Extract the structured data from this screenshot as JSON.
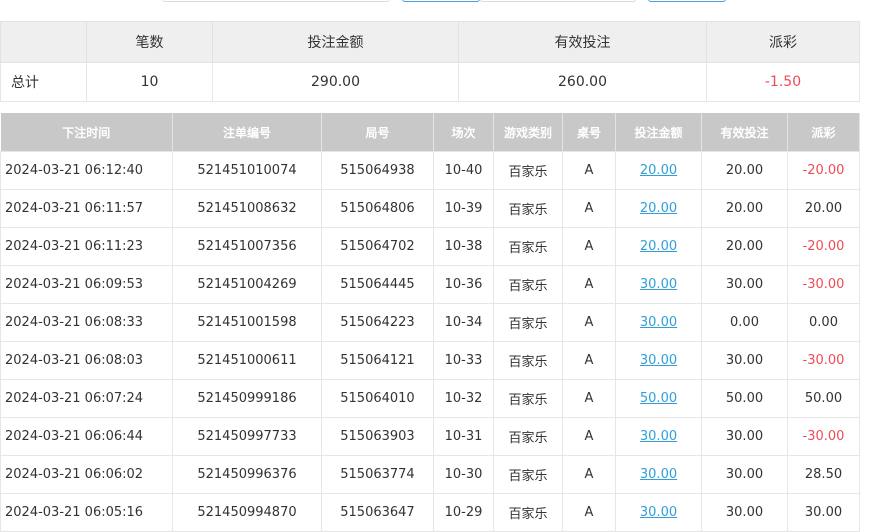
{
  "summary": {
    "headers": [
      "",
      "笔数",
      "投注金额",
      "有效投注",
      "派彩"
    ],
    "row": {
      "label": "总计",
      "count": "10",
      "bet_amount": "290.00",
      "valid_bet": "260.00",
      "payout": "-1.50"
    }
  },
  "detail": {
    "headers": [
      "下注时间",
      "注单编号",
      "局号",
      "场次",
      "游戏类别",
      "桌号",
      "投注金额",
      "有效投注",
      "派彩"
    ],
    "rows": [
      {
        "time": "2024-03-21 06:12:40",
        "bet_id": "521451010074",
        "round_id": "515064938",
        "session": "10-40",
        "game": "百家乐",
        "table": "A",
        "bet_amount": "20.00",
        "valid_bet": "20.00",
        "payout": "-20.00"
      },
      {
        "time": "2024-03-21 06:11:57",
        "bet_id": "521451008632",
        "round_id": "515064806",
        "session": "10-39",
        "game": "百家乐",
        "table": "A",
        "bet_amount": "20.00",
        "valid_bet": "20.00",
        "payout": "20.00"
      },
      {
        "time": "2024-03-21 06:11:23",
        "bet_id": "521451007356",
        "round_id": "515064702",
        "session": "10-38",
        "game": "百家乐",
        "table": "A",
        "bet_amount": "20.00",
        "valid_bet": "20.00",
        "payout": "-20.00"
      },
      {
        "time": "2024-03-21 06:09:53",
        "bet_id": "521451004269",
        "round_id": "515064445",
        "session": "10-36",
        "game": "百家乐",
        "table": "A",
        "bet_amount": "30.00",
        "valid_bet": "30.00",
        "payout": "-30.00"
      },
      {
        "time": "2024-03-21 06:08:33",
        "bet_id": "521451001598",
        "round_id": "515064223",
        "session": "10-34",
        "game": "百家乐",
        "table": "A",
        "bet_amount": "30.00",
        "valid_bet": "0.00",
        "payout": "0.00"
      },
      {
        "time": "2024-03-21 06:08:03",
        "bet_id": "521451000611",
        "round_id": "515064121",
        "session": "10-33",
        "game": "百家乐",
        "table": "A",
        "bet_amount": "30.00",
        "valid_bet": "30.00",
        "payout": "-30.00"
      },
      {
        "time": "2024-03-21 06:07:24",
        "bet_id": "521450999186",
        "round_id": "515064010",
        "session": "10-32",
        "game": "百家乐",
        "table": "A",
        "bet_amount": "50.00",
        "valid_bet": "50.00",
        "payout": "50.00"
      },
      {
        "time": "2024-03-21 06:06:44",
        "bet_id": "521450997733",
        "round_id": "515063903",
        "session": "10-31",
        "game": "百家乐",
        "table": "A",
        "bet_amount": "30.00",
        "valid_bet": "30.00",
        "payout": "-30.00"
      },
      {
        "time": "2024-03-21 06:06:02",
        "bet_id": "521450996376",
        "round_id": "515063774",
        "session": "10-30",
        "game": "百家乐",
        "table": "A",
        "bet_amount": "30.00",
        "valid_bet": "30.00",
        "payout": "28.50"
      },
      {
        "time": "2024-03-21 06:05:16",
        "bet_id": "521450994870",
        "round_id": "515063647",
        "session": "10-29",
        "game": "百家乐",
        "table": "A",
        "bet_amount": "30.00",
        "valid_bet": "30.00",
        "payout": "30.00"
      }
    ]
  },
  "colors": {
    "negative": "#ef4b59",
    "link": "#2f9fd9",
    "detail_header_bg": "#c8c8c8",
    "summary_header_bg": "#efefef"
  }
}
